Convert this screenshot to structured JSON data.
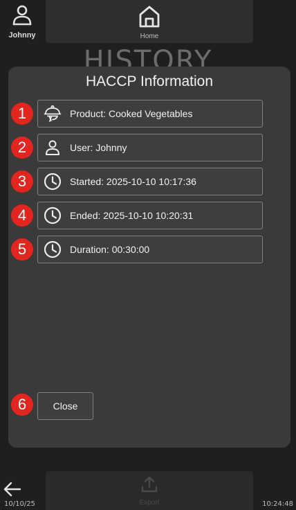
{
  "header": {
    "user_name": "Johnny",
    "home_label": "Home",
    "page_title": "HISTORY"
  },
  "modal": {
    "title": "HACCP Information",
    "rows": [
      {
        "badge": "1",
        "icon": "food-cloche-icon",
        "text": "Product: Cooked Vegetables"
      },
      {
        "badge": "2",
        "icon": "user-icon",
        "text": "User: Johnny"
      },
      {
        "badge": "3",
        "icon": "clock-icon",
        "text": "Started: 2025-10-10 10:17:36"
      },
      {
        "badge": "4",
        "icon": "clock-icon",
        "text": "Ended: 2025-10-10 10:20:31"
      },
      {
        "badge": "5",
        "icon": "clock-icon",
        "text": "Duration: 00:30:00"
      }
    ],
    "close_badge": "6",
    "close_label": "Close"
  },
  "footer": {
    "export_label": "Export",
    "date": "10/10/25",
    "time": "10:24:48"
  },
  "colors": {
    "badge": "#e2261f",
    "background": "#1f1f1f",
    "modal": "#3a3a3a"
  }
}
